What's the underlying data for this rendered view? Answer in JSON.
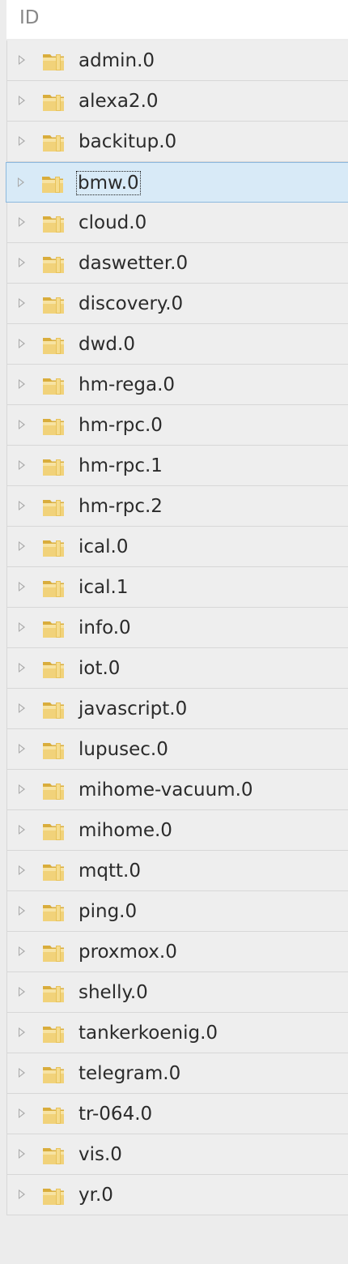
{
  "header": {
    "label": "ID"
  },
  "items": [
    {
      "label": "admin.0"
    },
    {
      "label": "alexa2.0"
    },
    {
      "label": "backitup.0"
    },
    {
      "label": "bmw.0",
      "selected": true
    },
    {
      "label": "cloud.0"
    },
    {
      "label": "daswetter.0"
    },
    {
      "label": "discovery.0"
    },
    {
      "label": "dwd.0"
    },
    {
      "label": "hm-rega.0"
    },
    {
      "label": "hm-rpc.0"
    },
    {
      "label": "hm-rpc.1"
    },
    {
      "label": "hm-rpc.2"
    },
    {
      "label": "ical.0"
    },
    {
      "label": "ical.1"
    },
    {
      "label": "info.0"
    },
    {
      "label": "iot.0"
    },
    {
      "label": "javascript.0"
    },
    {
      "label": "lupusec.0"
    },
    {
      "label": "mihome-vacuum.0"
    },
    {
      "label": "mihome.0"
    },
    {
      "label": "mqtt.0"
    },
    {
      "label": "ping.0"
    },
    {
      "label": "proxmox.0"
    },
    {
      "label": "shelly.0"
    },
    {
      "label": "tankerkoenig.0"
    },
    {
      "label": "telegram.0"
    },
    {
      "label": "tr-064.0"
    },
    {
      "label": "vis.0"
    },
    {
      "label": "yr.0"
    }
  ],
  "icons": {
    "expander": "triangle-right-icon",
    "node": "folder-icon"
  },
  "colors": {
    "selected_bg": "#d8eaf7",
    "selected_border": "#8cb8de",
    "folder": "#e8c25a"
  }
}
